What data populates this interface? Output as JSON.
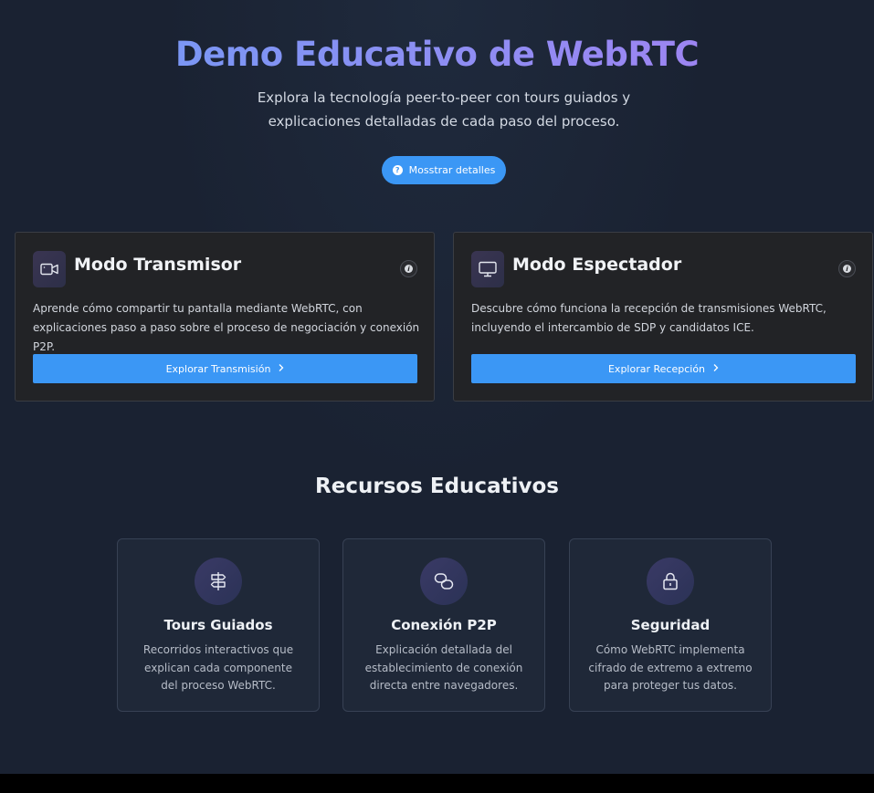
{
  "hero": {
    "title": "Demo Educativo de WebRTC",
    "subtitle": "Explora la tecnología peer-to-peer con tours guiados y explicaciones detalladas de cada paso del proceso.",
    "details_button": "Mosstrar detalles"
  },
  "modes": [
    {
      "title": "Modo Transmisor",
      "icon": "video-camera-icon",
      "description": "Aprende cómo compartir tu pantalla mediante WebRTC, con explicaciones paso a paso sobre el proceso de negociación y conexión P2P.",
      "button": "Explorar Transmisión"
    },
    {
      "title": "Modo Espectador",
      "icon": "monitor-icon",
      "description": "Descubre cómo funciona la recepción de transmisiones WebRTC, incluyendo el intercambio de SDP y candidatos ICE.",
      "button": "Explorar Recepción"
    }
  ],
  "resources": {
    "title": "Recursos Educativos",
    "items": [
      {
        "icon": "signpost-icon",
        "title": "Tours Guiados",
        "description": "Recorridos interactivos que explican cada componente del proceso WebRTC."
      },
      {
        "icon": "link-icon",
        "title": "Conexión P2P",
        "description": "Explicación detallada del establecimiento de conexión directa entre navegadores."
      },
      {
        "icon": "lock-icon",
        "title": "Seguridad",
        "description": "Cómo WebRTC implementa cifrado de extremo a extremo para proteger tus datos."
      }
    ]
  },
  "colors": {
    "accent": "#3b97f5",
    "background": "#1a2232",
    "card": "#222326",
    "title_gradient_start": "#6e9cf5",
    "title_gradient_end": "#a77ff2"
  }
}
